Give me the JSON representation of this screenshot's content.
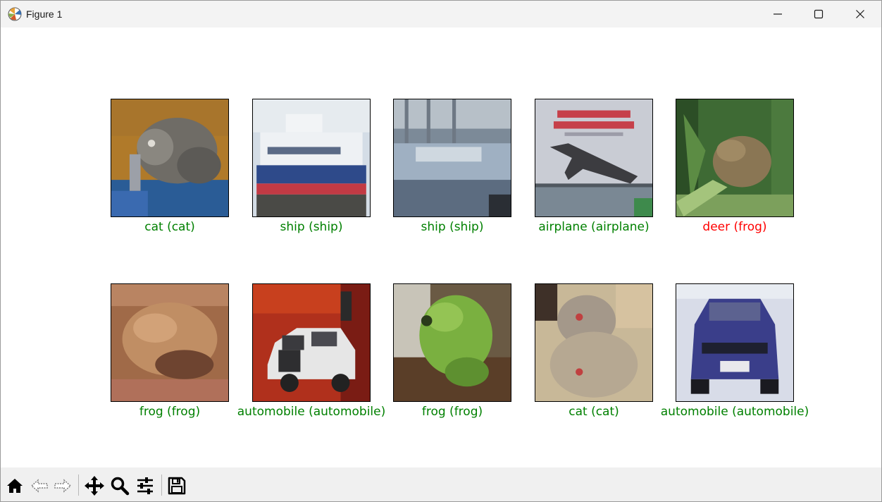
{
  "window": {
    "title": "Figure 1",
    "icons": {
      "app": "matplotlib-logo-icon",
      "minimize": "minimize-icon",
      "maximize": "maximize-icon",
      "close": "close-icon"
    }
  },
  "figure": {
    "rows": [
      [
        {
          "subject": "cat",
          "caption": "cat (cat)",
          "correct": true
        },
        {
          "subject": "ship",
          "caption": "ship (ship)",
          "correct": true
        },
        {
          "subject": "ship",
          "caption": "ship (ship)",
          "correct": true
        },
        {
          "subject": "airplane",
          "caption": "airplane (airplane)",
          "correct": true
        },
        {
          "subject": "frog",
          "caption": "deer (frog)",
          "correct": false
        }
      ],
      [
        {
          "subject": "frog",
          "caption": "frog (frog)",
          "correct": true
        },
        {
          "subject": "automobile",
          "caption": "automobile (automobile)",
          "correct": true
        },
        {
          "subject": "frog",
          "caption": "frog (frog)",
          "correct": true
        },
        {
          "subject": "cat",
          "caption": "cat (cat)",
          "correct": true
        },
        {
          "subject": "automobile",
          "caption": "automobile (automobile)",
          "correct": true
        }
      ]
    ],
    "colors": {
      "correct": "#008000",
      "wrong": "#ff0000"
    }
  },
  "toolbar": {
    "buttons": [
      "home-icon",
      "back-icon",
      "forward-icon",
      "pan-icon",
      "zoom-icon",
      "configure-subplots-icon",
      "save-icon"
    ]
  }
}
